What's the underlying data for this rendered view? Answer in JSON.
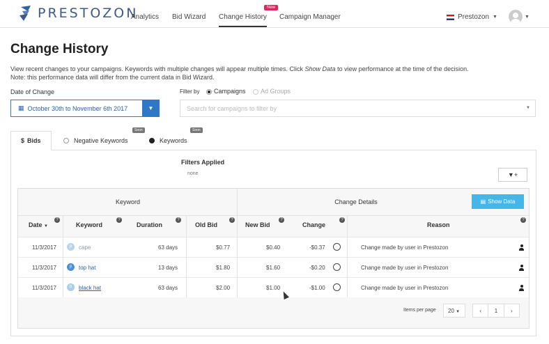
{
  "brand": {
    "name": "PRESTOZON"
  },
  "nav": {
    "items": [
      {
        "label": "Analytics"
      },
      {
        "label": "Bid Wizard"
      },
      {
        "label": "Change History"
      },
      {
        "label": "Campaign Manager"
      }
    ],
    "new_badge": "New",
    "account": "Prestozon"
  },
  "page": {
    "title": "Change History",
    "desc_line1_pre": "View recent changes to your campaigns. Keywords with multiple changes will appear multiple times. Click ",
    "desc_line1_em": "Show Data",
    "desc_line1_post": " to view performance at the time of the decision.",
    "desc_line2": "Note: this performance data will differ from the current data in Bid Wizard."
  },
  "filters": {
    "date_label": "Date of Change",
    "date_value": "October 30th to November 6th 2017",
    "filter_by_label": "Filter by",
    "opt_campaigns": "Campaigns",
    "opt_adgroups": "Ad Groups",
    "search_placeholder": "Search for campaigns to filter by",
    "applied_title": "Filters Applied",
    "applied_value": "none"
  },
  "tabs": [
    {
      "label": "Bids",
      "icon": "dollar-icon"
    },
    {
      "label": "Negative Keywords",
      "soon": "Soon"
    },
    {
      "label": "Keywords",
      "soon": "Soon"
    }
  ],
  "table": {
    "group_keyword": "Keyword",
    "group_change": "Change Details",
    "show_data": "Show Data",
    "headers": [
      "Date",
      "Keyword",
      "Duration",
      "Old Bid",
      "New Bid",
      "Change",
      "Reason"
    ],
    "rows": [
      {
        "date": "11/3/2017",
        "kw_icon": "p",
        "keyword": "cape",
        "duration": "63 days",
        "old": "$0.77",
        "new": "$0.40",
        "change": "-$0.37",
        "reason": "Change made by user in Prestozon"
      },
      {
        "date": "11/3/2017",
        "kw_icon": "p",
        "keyword": "top hat",
        "duration": "13 days",
        "old": "$1.80",
        "new": "$1.60",
        "change": "-$0.20",
        "reason": "Change made by user in Prestozon"
      },
      {
        "date": "11/3/2017",
        "kw_icon": "b",
        "keyword": "black hat",
        "duration": "63 days",
        "old": "$2.00",
        "new": "$1.00",
        "change": "-$1.00",
        "reason": "Change made by user in Prestozon"
      }
    ],
    "items_per_page_label": "Items per page",
    "items_per_page": "20",
    "page": "1"
  },
  "colors": {
    "accent": "#2e78c7",
    "show_data": "#45b6ea",
    "badge": "#e0245e"
  }
}
